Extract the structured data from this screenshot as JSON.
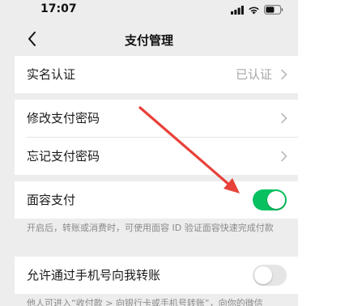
{
  "status_bar": {
    "time": "17:07",
    "icons": [
      "signal-icon",
      "wifi-icon",
      "battery-icon"
    ]
  },
  "nav": {
    "back_icon": "chevron-left-icon",
    "title": "支付管理"
  },
  "sections": {
    "identity": {
      "label": "实名认证",
      "value": "已认证"
    },
    "password": {
      "modify_label": "修改支付密码",
      "forgot_label": "忘记支付密码"
    },
    "face_pay": {
      "label": "面容支付",
      "enabled": true,
      "note": "开启后，转账或消费时，可使用面容 ID 验证面容快速完成付款"
    },
    "phone_transfer": {
      "label": "允许通过手机号向我转账",
      "enabled": false,
      "note": "他人可进入“收付款 > 向银行卡或手机号转账”，向你的微信"
    }
  },
  "colors": {
    "accent_green": "#07c160",
    "annotation_red": "#e8413a",
    "page_bg": "#ededed"
  }
}
